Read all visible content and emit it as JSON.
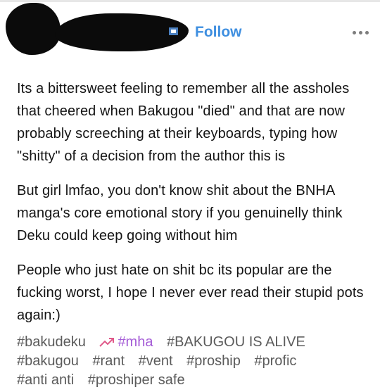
{
  "header": {
    "follow_label": "Follow",
    "blog_icon": "blog-icon",
    "more_icon": "more-dots-icon"
  },
  "post": {
    "paragraphs": [
      "Its a bittersweet feeling to remember all the assholes that cheered when Bakugou \"died\" and that are now probably screeching at their keyboards, typing how \"shitty\" of a decision from the author this is",
      "But girl lmfao, you don't know shit about the BNHA manga's core emotional story if you genuinelly think Deku could keep going without him",
      "People who just hate on shit bc its popular are the fucking worst, I hope I never ever read their stupid pots again:)"
    ]
  },
  "tags": {
    "row1": [
      "#bakudeku",
      "#mha",
      "#BAKUGOU IS ALIVE"
    ],
    "row2": [
      "#bakugou",
      "#rant",
      "#vent",
      "#proship",
      "#profic"
    ],
    "row3": [
      "#anti anti",
      "#proshiper safe"
    ],
    "trending_tag": "#mha",
    "trending_icon": "trending-arrow-icon",
    "trending_color": "#a45bd6"
  },
  "colors": {
    "follow": "#3f8fe0",
    "text": "#141414",
    "tag_text": "#5b5b5b"
  }
}
